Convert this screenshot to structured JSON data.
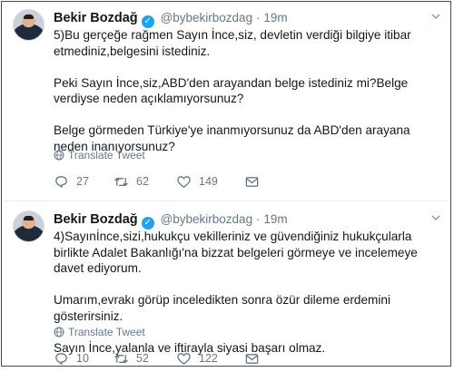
{
  "tweets": [
    {
      "name": "Bekir Bozdağ",
      "verified_mark": "✓",
      "handle": "@bybekirbozdag",
      "separator": "·",
      "time": "19m",
      "paragraphs": [
        "5)Bu gerçeğe rağmen Sayın İnce,siz, devletin verdiği bilgiye itibar etmediniz,belgesini istediniz.",
        "Peki Sayın İnce,siz,ABD'den arayandan belge istediniz mi?Belge verdiyse neden açıklamıyorsunuz?",
        "Belge görmeden Türkiye'ye inanmıyorsunuz da ABD'den arayana neden inanıyorsunuz?"
      ],
      "translate_label": "Translate Tweet",
      "reply_count": "27",
      "retweet_count": "62",
      "like_count": "149"
    },
    {
      "name": "Bekir Bozdağ",
      "verified_mark": "✓",
      "handle": "@bybekirbozdag",
      "separator": "·",
      "time": "19m",
      "paragraphs": [
        "4)Sayınİnce,sizi,hukukçu vekilleriniz ve güvendiğiniz hukukçularla birlikte Adalet Bakanlığı'na bizzat belgeleri görmeye ve incelemeye davet ediyorum.",
        "Umarım,evrakı görüp inceledikten sonra özür dileme erdemini gösterirsiniz.",
        "Sayın İnce,yalanla ve iftirayla siyasi başarı olmaz."
      ],
      "translate_label": "Translate Tweet",
      "reply_count": "10",
      "retweet_count": "52",
      "like_count": "122"
    }
  ],
  "icons": [
    "avatar",
    "verified-badge-icon",
    "chevron-down-icon",
    "globe-icon",
    "reply-icon",
    "retweet-icon",
    "like-icon",
    "direct-message-icon"
  ],
  "colors": {
    "accent": "#1da1f2",
    "secondary_text": "#657786",
    "text": "#14171a"
  }
}
